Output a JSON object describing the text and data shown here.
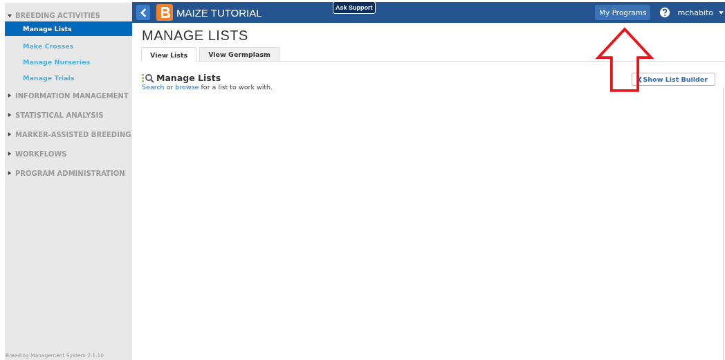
{
  "sidebar": {
    "sections": [
      {
        "label": "BREEDING ACTIVITIES",
        "expanded": true,
        "children": [
          {
            "label": "Manage Lists",
            "selected": true
          },
          {
            "label": "Make Crosses",
            "selected": false
          },
          {
            "label": "Manage Nurseries",
            "selected": false
          },
          {
            "label": "Manage Trials",
            "selected": false
          }
        ]
      },
      {
        "label": "INFORMATION MANAGEMENT",
        "expanded": false
      },
      {
        "label": "STATISTICAL ANALYSIS",
        "expanded": false
      },
      {
        "label": "MARKER-ASSISTED BREEDING",
        "expanded": false
      },
      {
        "label": "WORKFLOWS",
        "expanded": false
      },
      {
        "label": "PROGRAM ADMINISTRATION",
        "expanded": false
      }
    ],
    "footer": "Breeding Management System 2.1.10"
  },
  "header": {
    "program": "MAIZE TUTORIAL",
    "ask_support": "Ask Support",
    "my_programs": "My Programs",
    "user": "mchabito"
  },
  "page": {
    "title": "MANAGE LISTS",
    "tabs": [
      {
        "label": "View Lists",
        "selected": true
      },
      {
        "label": "View Germplasm",
        "selected": false
      }
    ],
    "section_title": "Manage Lists",
    "link_1": "Search",
    "text_1": "or",
    "link_2": "browse",
    "text_2": "for a list to work with.",
    "show_list_builder": "Show List Builder"
  }
}
